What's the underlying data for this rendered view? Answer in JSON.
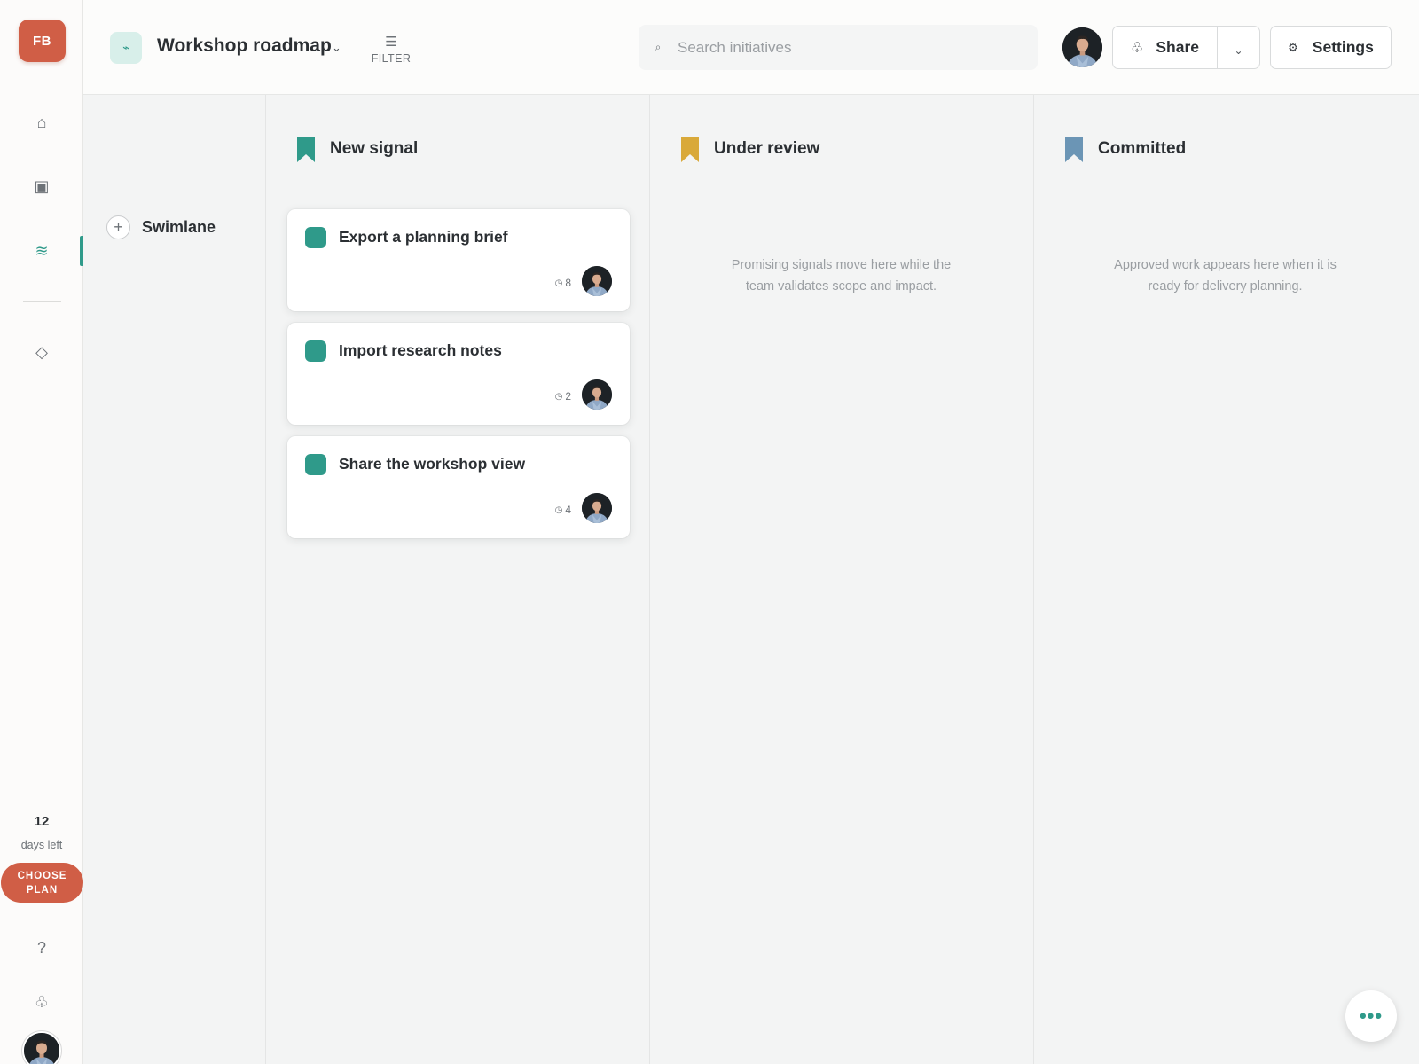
{
  "workspace": {
    "logo_text": "FB"
  },
  "nav": {
    "items": [
      {
        "name": "home-icon",
        "glyph": "⌂"
      },
      {
        "name": "board-icon",
        "glyph": "▣"
      },
      {
        "name": "roadmap-icon",
        "glyph": "≋"
      },
      {
        "name": "insights-icon",
        "glyph": "◇"
      }
    ],
    "help_glyph": "?",
    "integrations_glyph": "♧"
  },
  "trial": {
    "days": "12",
    "label": "days left",
    "cta": "CHOOSE PLAN"
  },
  "header": {
    "board_icon_glyph": "⌁",
    "board_title": "Workshop roadmap",
    "board_chevron": "⌄",
    "filter_glyph": "☰",
    "filter_label": "FILTER",
    "search_glyph": "⌕",
    "search_placeholder": "Search initiatives",
    "share_glyph": "♧",
    "share_label": "Share",
    "share_chevron": "⌄",
    "settings_glyph": "⚙",
    "settings_label": "Settings"
  },
  "colors": {
    "accent": "#2f9a8a",
    "brand": "#d05e46",
    "new_signal": "#2f9a8a",
    "under_review": "#d9a93a",
    "committed": "#6b95b5"
  },
  "columns": [
    {
      "title": "New signal",
      "color": "#2f9a8a"
    },
    {
      "title": "Under review",
      "color": "#d9a93a",
      "empty_text": "Promising signals move here while the team validates scope and impact."
    },
    {
      "title": "Committed",
      "color": "#6b95b5",
      "empty_text": "Approved work appears here when it is ready for delivery planning."
    }
  ],
  "swimlane": {
    "add_glyph": "+",
    "label": "Swimlane"
  },
  "cards": [
    {
      "title": "Export a planning brief",
      "count": "8"
    },
    {
      "title": "Import research notes",
      "count": "2"
    },
    {
      "title": "Share the workshop view",
      "count": "4"
    }
  ],
  "card_count_glyph": "◷",
  "fab_glyph": "•••"
}
